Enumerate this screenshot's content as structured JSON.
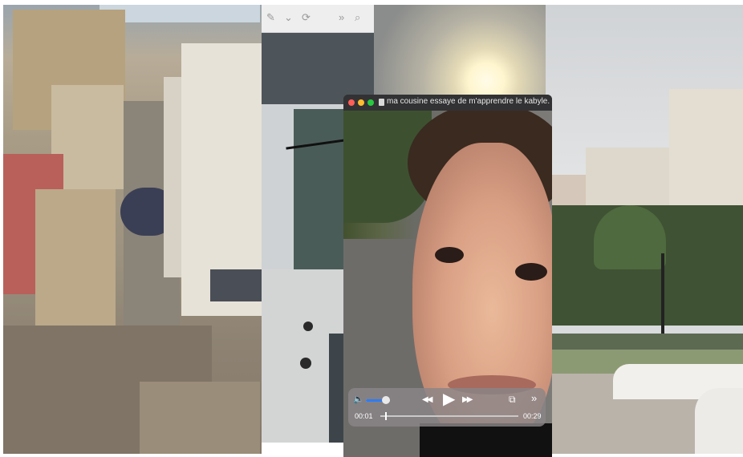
{
  "photos": [
    {
      "name": "alley-photo"
    },
    {
      "name": "balcony-photo"
    },
    {
      "name": "sun-photo"
    },
    {
      "name": "plaza-photo"
    }
  ],
  "viewer_toolbar": {
    "icons": [
      "pencil-icon",
      "chevron-down-icon",
      "rotate-icon",
      "more-icon",
      "search-icon"
    ],
    "glyphs": {
      "pencil": "✎",
      "chevron": "⌄",
      "rotate": "⟳",
      "more": "»",
      "search": "⌕"
    }
  },
  "player": {
    "title": "ma cousine essaye de m'apprendre le kabyle...",
    "traffic_lights": {
      "close": "#ff5f57",
      "minimize": "#febc2e",
      "zoom": "#28c840"
    },
    "controls": {
      "volume_glyph": "🔈",
      "volume_level": 0.75,
      "rewind_glyph": "◀◀",
      "play_glyph": "▶",
      "forward_glyph": "▶▶",
      "pip_glyph": "⧉",
      "more_glyph": "»",
      "current_time": "00:01",
      "duration": "00:29",
      "progress": 0.035
    }
  }
}
